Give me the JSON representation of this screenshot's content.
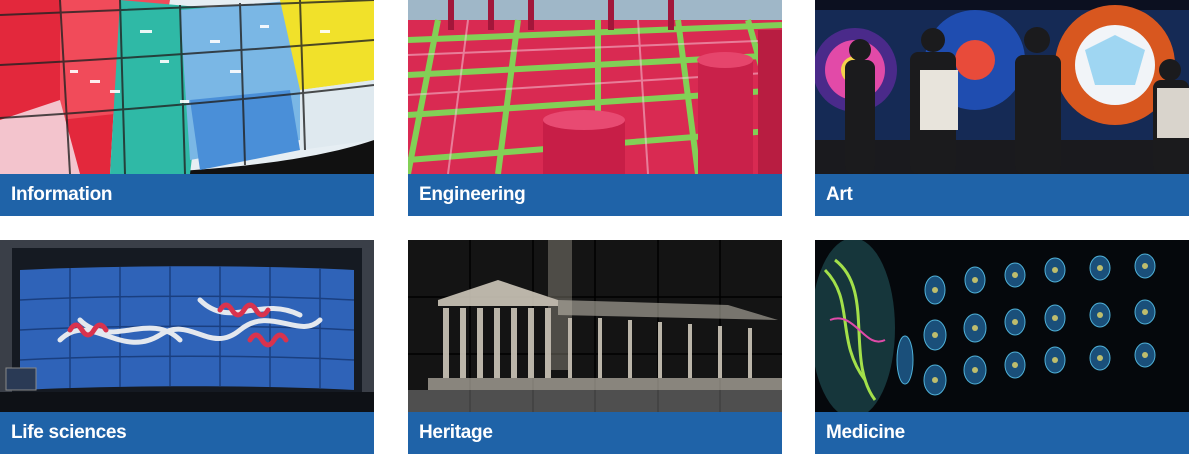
{
  "tiles": [
    {
      "label": "Information",
      "image": "information-display-wall"
    },
    {
      "label": "Engineering",
      "image": "engineering-pipes-visualization"
    },
    {
      "label": "Art",
      "image": "art-installation-visitors"
    },
    {
      "label": "Life sciences",
      "image": "protein-structure-wall"
    },
    {
      "label": "Heritage",
      "image": "temple-point-cloud"
    },
    {
      "label": "Medicine",
      "image": "brain-scans-grid"
    }
  ]
}
